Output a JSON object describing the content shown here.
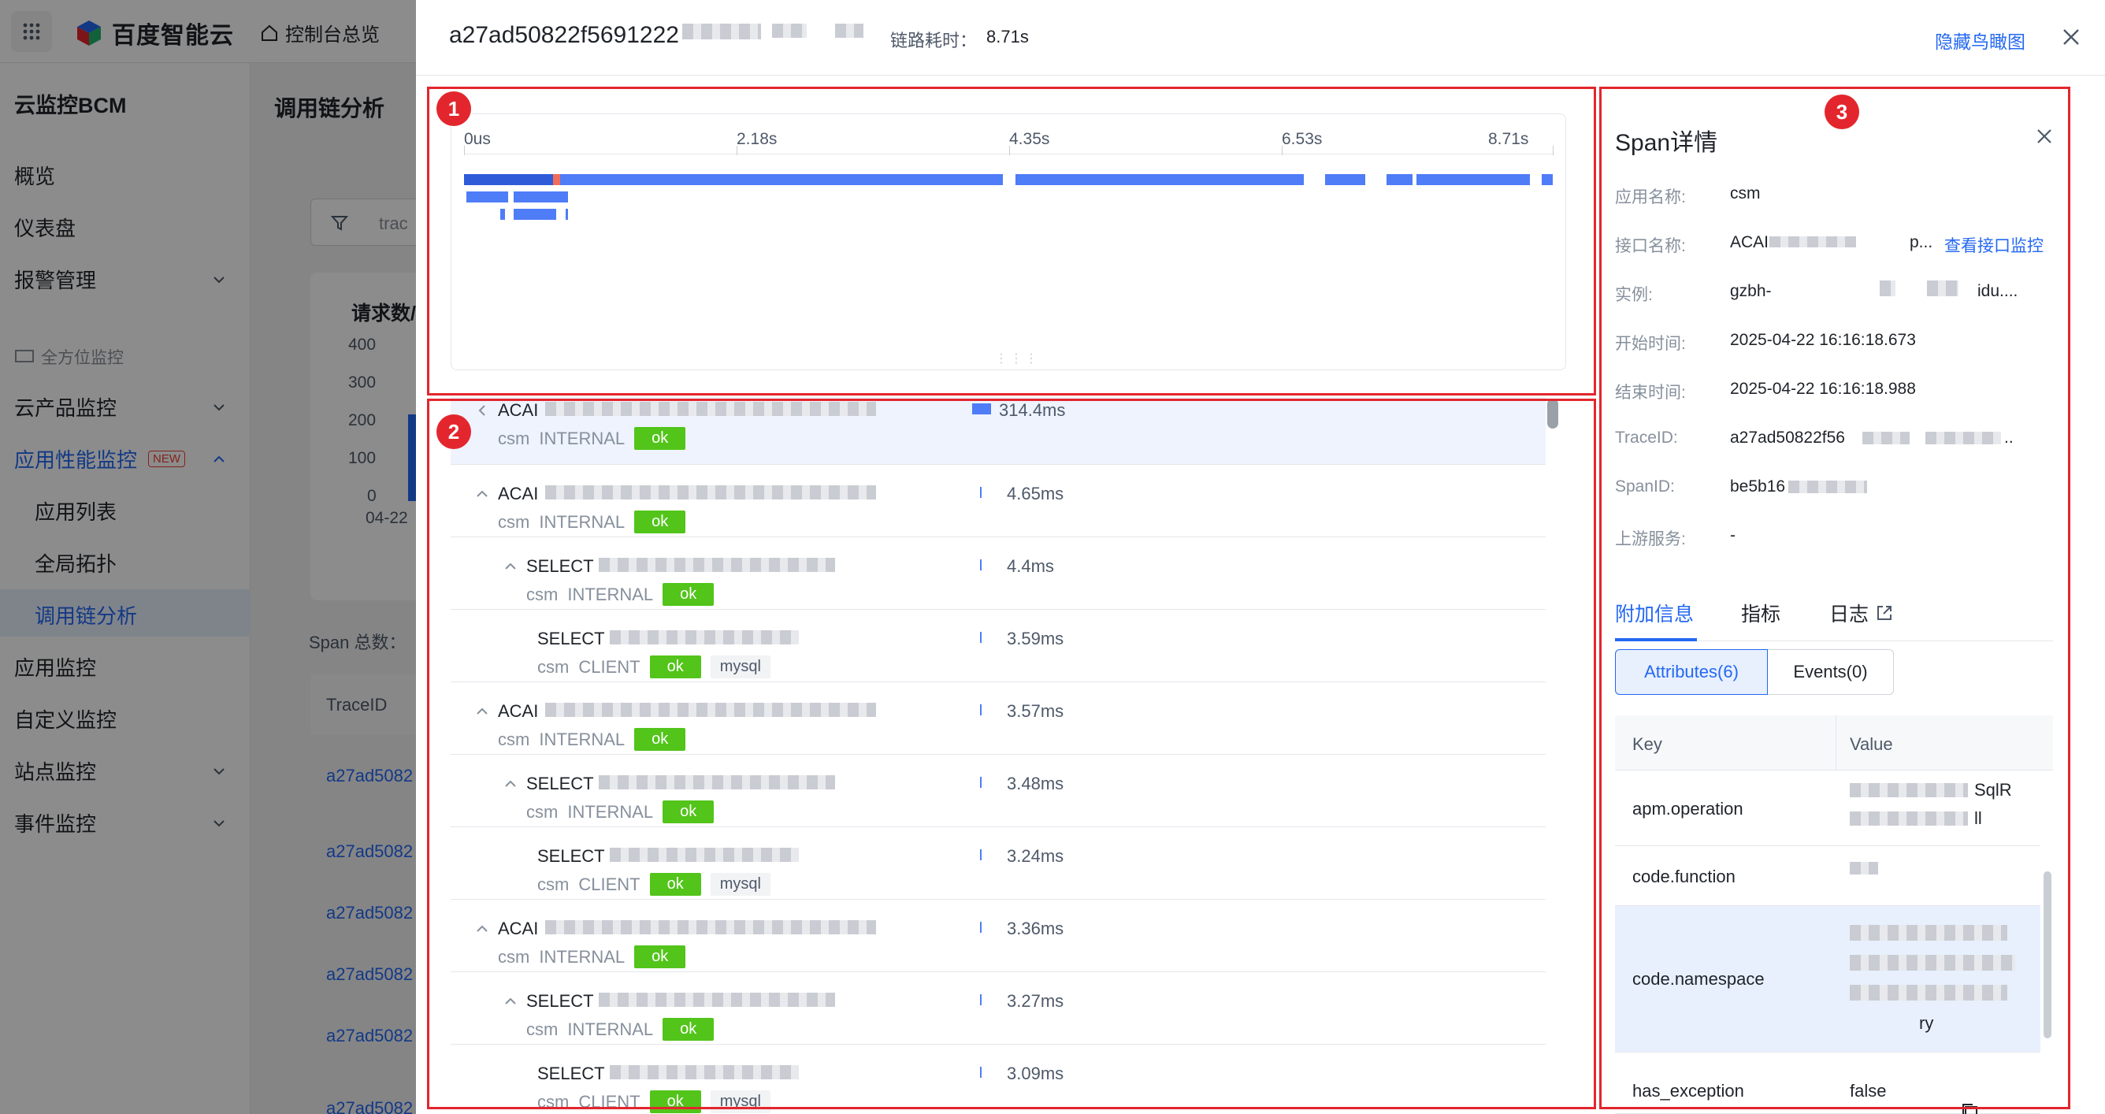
{
  "console": {
    "brand": "百度智能云",
    "home_link": "控制台总览",
    "sidebar_title": "云监控BCM",
    "nav": [
      {
        "label": "概览"
      },
      {
        "label": "仪表盘"
      },
      {
        "label": "报警管理"
      },
      {
        "label": "全方位监控"
      },
      {
        "label": "云产品监控"
      },
      {
        "label": "应用性能监控",
        "badge": "NEW"
      },
      {
        "label": "应用列表"
      },
      {
        "label": "全局拓扑"
      },
      {
        "label": "调用链分析"
      },
      {
        "label": "应用监控"
      },
      {
        "label": "自定义监控"
      },
      {
        "label": "站点监控"
      },
      {
        "label": "事件监控"
      }
    ],
    "page_title": "调用链分析",
    "filter_text": "trac",
    "chart_title": "请求数/",
    "y_ticks": [
      "400",
      "300",
      "200",
      "100",
      "0"
    ],
    "x_tick": "04-22",
    "span_total": "Span 总数：",
    "trace_header": "TraceID",
    "trace_links": [
      "a27ad5082",
      "a27ad5082",
      "a27ad5082",
      "a27ad5082",
      "a27ad5082",
      "a27ad5082"
    ]
  },
  "drawer": {
    "trace_id": "a27ad50822f5691222",
    "duration_label": "链路耗时：",
    "duration_value": "8.71s",
    "hide_map": "隐藏鸟瞰图"
  },
  "annotations": [
    "1",
    "2",
    "3"
  ],
  "timeline": {
    "ticks": [
      "0us",
      "2.18s",
      "4.35s",
      "6.53s",
      "8.71s"
    ],
    "total_s": 8.71,
    "main_segments_s": [
      [
        0,
        0.71,
        "#2f5bd9"
      ],
      [
        0.71,
        0.77,
        "#f06c58"
      ],
      [
        0.77,
        4.31,
        "#4f7cf7"
      ],
      [
        4.41,
        6.72,
        "#4f7cf7"
      ],
      [
        6.89,
        7.21,
        "#4f7cf7"
      ],
      [
        7.38,
        7.59,
        "#4f7cf7"
      ],
      [
        7.62,
        8.53,
        "#4f7cf7"
      ],
      [
        8.62,
        8.71,
        "#4f7cf7"
      ]
    ],
    "lane2_segments_s": [
      [
        0.02,
        0.35
      ],
      [
        0.4,
        0.83
      ]
    ],
    "lane3_segments_s": [
      [
        0.29,
        0.33
      ],
      [
        0.4,
        0.74
      ],
      [
        0.81,
        0.83
      ]
    ]
  },
  "span_kinds": {
    "internal": "INTERNAL",
    "client": "CLIENT"
  },
  "spans": [
    {
      "name": "ACAI",
      "service": "csm",
      "kind": "INTERNAL",
      "status": "ok",
      "db": "",
      "duration": "314.4ms",
      "level": 0,
      "selected": true
    },
    {
      "name": "ACAI",
      "service": "csm",
      "kind": "INTERNAL",
      "status": "ok",
      "db": "",
      "duration": "4.65ms",
      "level": 0,
      "selected": false
    },
    {
      "name": "SELECT",
      "service": "csm",
      "kind": "INTERNAL",
      "status": "ok",
      "db": "",
      "duration": "4.4ms",
      "level": 1,
      "selected": false
    },
    {
      "name": "SELECT",
      "service": "csm",
      "kind": "CLIENT",
      "status": "ok",
      "db": "mysql",
      "duration": "3.59ms",
      "level": 2,
      "selected": false
    },
    {
      "name": "ACAI",
      "service": "csm",
      "kind": "INTERNAL",
      "status": "ok",
      "db": "",
      "duration": "3.57ms",
      "level": 0,
      "selected": false
    },
    {
      "name": "SELECT",
      "service": "csm",
      "kind": "INTERNAL",
      "status": "ok",
      "db": "",
      "duration": "3.48ms",
      "level": 1,
      "selected": false
    },
    {
      "name": "SELECT",
      "service": "csm",
      "kind": "CLIENT",
      "status": "ok",
      "db": "mysql",
      "duration": "3.24ms",
      "level": 2,
      "selected": false
    },
    {
      "name": "ACAI",
      "service": "csm",
      "kind": "INTERNAL",
      "status": "ok",
      "db": "",
      "duration": "3.36ms",
      "level": 0,
      "selected": false
    },
    {
      "name": "SELECT",
      "service": "csm",
      "kind": "INTERNAL",
      "status": "ok",
      "db": "",
      "duration": "3.27ms",
      "level": 1,
      "selected": false
    },
    {
      "name": "SELECT",
      "service": "csm",
      "kind": "CLIENT",
      "status": "ok",
      "db": "mysql",
      "duration": "3.09ms",
      "level": 2,
      "selected": false
    }
  ],
  "detail": {
    "title": "Span详情",
    "fields": [
      {
        "label": "应用名称:",
        "value": "csm"
      },
      {
        "label": "接口名称:",
        "value": "ACAI"
      },
      {
        "label": "实例:",
        "value": "gzbh-"
      },
      {
        "label": "开始时间:",
        "value": "2025-04-22 16:16:18.673"
      },
      {
        "label": "结束时间:",
        "value": "2025-04-22 16:16:18.988"
      },
      {
        "label": "TraceID:",
        "value": "a27ad50822f56"
      },
      {
        "label": "SpanID:",
        "value": "be5b16"
      },
      {
        "label": "上游服务:",
        "value": "-"
      }
    ],
    "interface_suffix": "p...",
    "instance_suffix": "idu....",
    "traceid_suffix": "..",
    "view_monitor": "查看接口监控",
    "tabs": [
      "附加信息",
      "指标",
      "日志"
    ],
    "segments": [
      "Attributes(6)",
      "Events(0)"
    ],
    "table_headers": [
      "Key",
      "Value"
    ],
    "attributes": [
      {
        "key": "apm.operation",
        "value": "SqlR",
        "value2": "ll"
      },
      {
        "key": "code.function",
        "value": ""
      },
      {
        "key": "code.namespace",
        "value": "ry"
      },
      {
        "key": "has_exception",
        "value": "false"
      }
    ]
  },
  "colors": {
    "accent": "#2468f2",
    "ok": "#52c41a",
    "annotation": "#e3262d",
    "bar": "#4f7cf7",
    "bar_error": "#f06c58"
  }
}
